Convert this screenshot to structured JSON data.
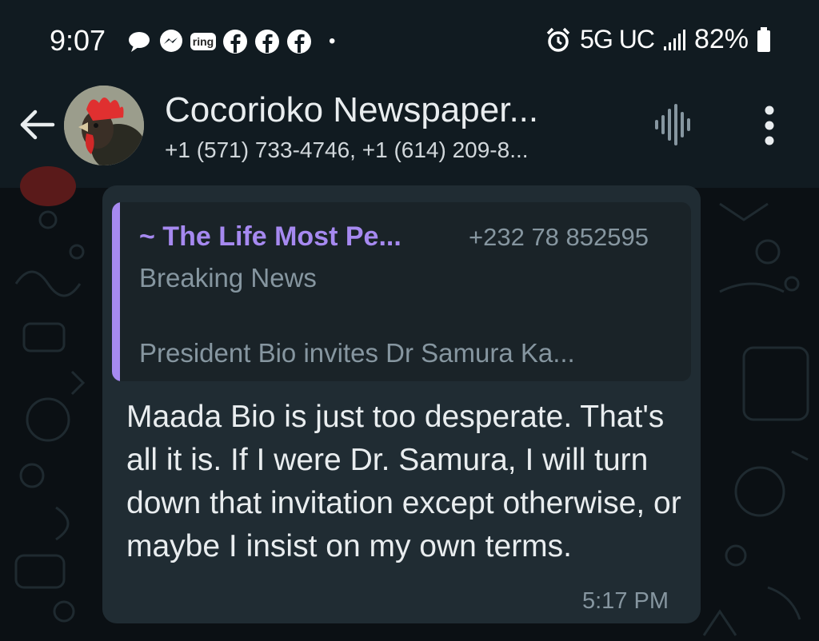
{
  "status_bar": {
    "time": "9:07",
    "ring_label": "ring",
    "network": "5G UC",
    "battery": "82%"
  },
  "header": {
    "title": "Cocorioko Newspaper...",
    "participants": "+1 (571) 733-4746, +1 (614) 209-8..."
  },
  "message": {
    "quote": {
      "author": "~ The Life Most Pe...",
      "phone": "+232 78 852595",
      "line1": "Breaking News",
      "line2": "President Bio invites Dr Samura Ka..."
    },
    "text": "Maada Bio is just too desperate. That's all it is. If I were Dr. Samura, I will turn down that invitation except otherwise, or maybe I insist on my own terms.",
    "time": "5:17 PM"
  },
  "colors": {
    "background": "#0b1014",
    "header_bg": "#111b21",
    "bubble_bg": "#202c33",
    "quote_accent": "#a689f0",
    "secondary_text": "#8696a0"
  }
}
